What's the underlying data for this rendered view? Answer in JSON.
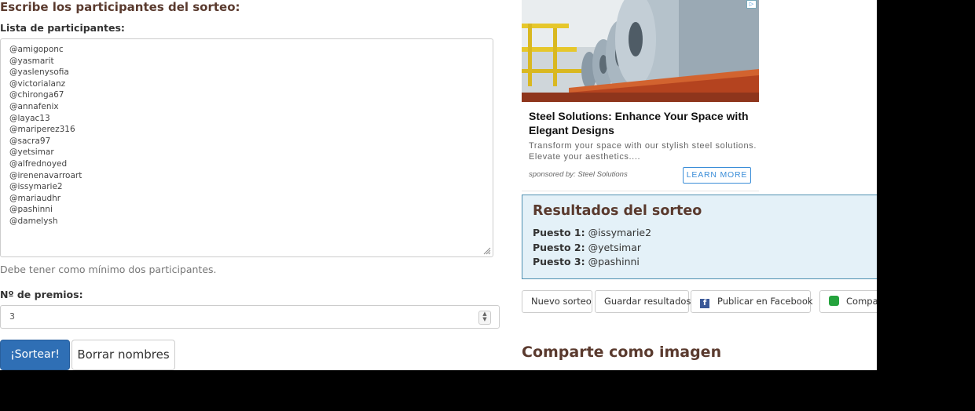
{
  "form": {
    "heading": "Escribe los participantes del sorteo:",
    "list_label": "Lista de participantes:",
    "participants": [
      "@amigoponc",
      "@yasmarit",
      "@yaslenysofia",
      "@victorialanz",
      "@chironga67",
      "@annafenix",
      "@layac13",
      "@mariperez316",
      "@sacra97",
      "@yetsimar",
      "@alfrednoyed",
      "@irenenavarroart",
      "@issymarie2",
      "@mariaudhr",
      "@pashinni",
      "@damelysh"
    ],
    "help_text": "Debe tener como mínimo dos participantes.",
    "prizes_label": "Nº de premios:",
    "prizes_value": "3",
    "draw_button": "¡Sortear!",
    "clear_button": "Borrar nombres"
  },
  "ad": {
    "title": "Steel Solutions: Enhance Your Space with Elegant Designs",
    "description": "Transform your space with our stylish steel solutions. Elevate your aesthetics....",
    "sponsor": "sponsored by: Steel Solutions",
    "cta": "LEARN MORE"
  },
  "results": {
    "title": "Resultados del sorteo",
    "positions": [
      {
        "label": "Puesto 1:",
        "value": "@issymarie2"
      },
      {
        "label": "Puesto 2:",
        "value": "@yetsimar"
      },
      {
        "label": "Puesto 3:",
        "value": "@pashinni"
      }
    ]
  },
  "actions": {
    "new_draw": "Nuevo sorteo",
    "save": "Guardar resultados",
    "facebook": "Publicar en Facebook",
    "whatsapp": "Compar"
  },
  "share": {
    "title": "Comparte como imagen"
  },
  "colors": {
    "heading": "#5a3a2e",
    "primary": "#2f6fb5",
    "results_bg": "#e4f1f8",
    "results_border": "#4e8fb0"
  }
}
